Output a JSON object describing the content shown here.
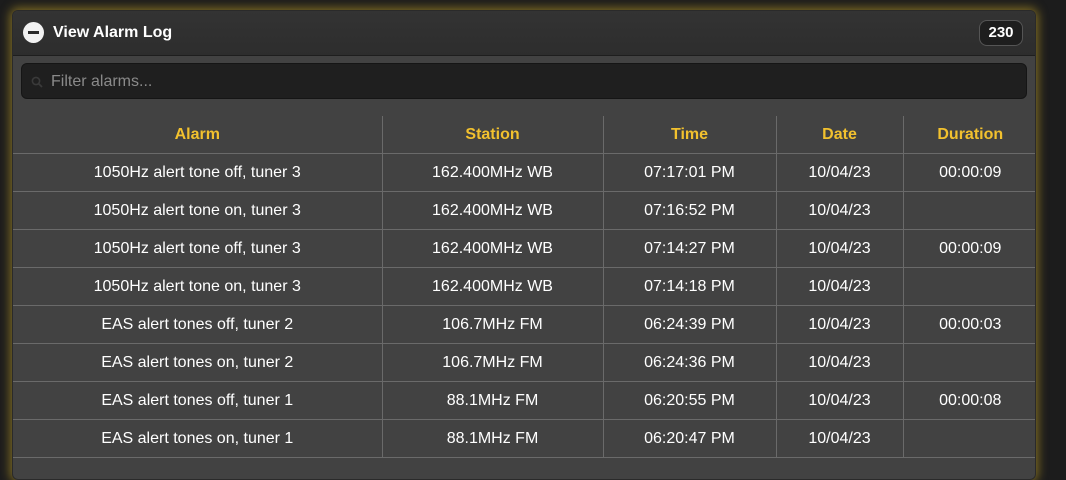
{
  "panel": {
    "title": "View Alarm Log",
    "count": "230",
    "accent_color": "#f2c12e",
    "glow_color": "#d6b028"
  },
  "filter": {
    "placeholder": "Filter alarms...",
    "value": ""
  },
  "table": {
    "columns": [
      "Alarm",
      "Station",
      "Time",
      "Date",
      "Duration"
    ],
    "rows": [
      [
        "1050Hz alert tone off, tuner 3",
        "162.400MHz WB",
        "07:17:01 PM",
        "10/04/23",
        "00:00:09"
      ],
      [
        "1050Hz alert tone on, tuner 3",
        "162.400MHz WB",
        "07:16:52 PM",
        "10/04/23",
        ""
      ],
      [
        "1050Hz alert tone off, tuner 3",
        "162.400MHz WB",
        "07:14:27 PM",
        "10/04/23",
        "00:00:09"
      ],
      [
        "1050Hz alert tone on, tuner 3",
        "162.400MHz WB",
        "07:14:18 PM",
        "10/04/23",
        ""
      ],
      [
        "EAS alert tones off, tuner 2",
        "106.7MHz FM",
        "06:24:39 PM",
        "10/04/23",
        "00:00:03"
      ],
      [
        "EAS alert tones on, tuner 2",
        "106.7MHz FM",
        "06:24:36 PM",
        "10/04/23",
        ""
      ],
      [
        "EAS alert tones off, tuner 1",
        "88.1MHz FM",
        "06:20:55 PM",
        "10/04/23",
        "00:00:08"
      ],
      [
        "EAS alert tones on, tuner 1",
        "88.1MHz FM",
        "06:20:47 PM",
        "10/04/23",
        ""
      ]
    ]
  },
  "icons": {
    "collapse": "minus-circle-icon",
    "search": "search-icon"
  }
}
